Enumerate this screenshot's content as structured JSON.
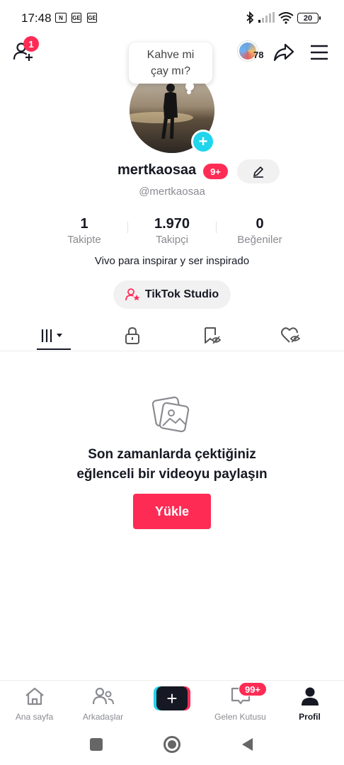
{
  "status_bar": {
    "time": "17:48",
    "sim1": "GE",
    "sim2": "GE",
    "battery": "20"
  },
  "header": {
    "add_friend_badge": "1",
    "story_count": "78"
  },
  "profile": {
    "note_bubble": "Kahve mi\nçay mı?",
    "note_line1": "Kahve mi",
    "note_line2": "çay mı?",
    "username": "mertkaosaa",
    "username_badge": "9+",
    "handle": "@mertkaosaa",
    "stats": [
      {
        "value": "1",
        "label": "Takipte"
      },
      {
        "value": "1.970",
        "label": "Takipçi"
      },
      {
        "value": "0",
        "label": "Beğeniler"
      }
    ],
    "bio": "Vivo para inspirar y ser inspirado",
    "studio_button": "TikTok Studio"
  },
  "tabs": [
    {
      "icon": "grid-icon",
      "active": true
    },
    {
      "icon": "lock-icon",
      "active": false
    },
    {
      "icon": "bookmark-hidden-icon",
      "active": false
    },
    {
      "icon": "heart-hidden-icon",
      "active": false
    }
  ],
  "empty_state": {
    "line1": "Son zamanlarda çektiğiniz",
    "line2": "eğlenceli bir videoyu paylaşın",
    "button": "Yükle"
  },
  "bottom_nav": {
    "home": "Ana sayfa",
    "friends": "Arkadaşlar",
    "inbox": "Gelen Kutusu",
    "inbox_badge": "99+",
    "profile": "Profil"
  },
  "colors": {
    "accent": "#fe2c55",
    "cyan": "#20d5ec",
    "text": "#161823",
    "muted": "#8a8b91"
  }
}
